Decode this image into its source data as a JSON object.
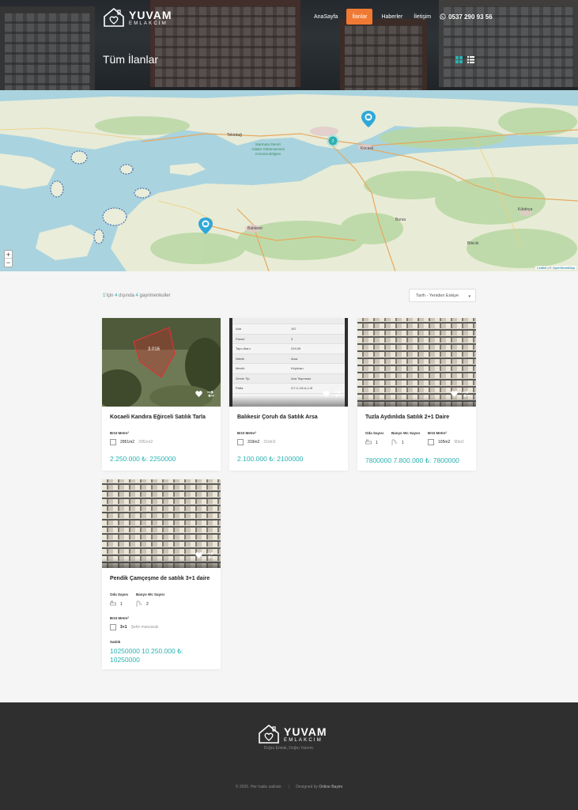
{
  "header": {
    "logo_title": "YUVAM",
    "logo_sub": "EMLAKCIM",
    "nav": [
      "AnaSayfa",
      "İlanlar",
      "Haberler",
      "İletişim"
    ],
    "active_nav": "İlanlar",
    "phone": "0537 290 93 56",
    "page_title": "Tüm İlanlar"
  },
  "map": {
    "labels": [
      "Tekirdağ",
      "Marmara Denizi Adalar Gülümsemesi Koruma Bölgesi",
      "Kocaeli",
      "Balıkesir",
      "Bursa",
      "Bilecik",
      "Kütahya"
    ],
    "cluster_count": "2",
    "zoom_in": "+",
    "zoom_out": "−",
    "attribution_leaflet": "Leaflet",
    "attribution_sep": " | © ",
    "attribution_osm": "OpenStreetMap"
  },
  "listing": {
    "count_prefix": "1",
    "count_mid": "'için ",
    "count_shown": "4",
    "count_text": " dışında ",
    "count_total": "4",
    "count_suffix": " gayrimenkuller",
    "sort_value": "Tarih - Yeniden Eskiye"
  },
  "cards": [
    {
      "title": "Kocaeli Kandıra Eğirceli Satılık Tarla",
      "brut_label": "Brüt Metre²",
      "brut_value": "2951m2",
      "brut_muted": "2951m2",
      "price": "2.250.000 ₺: 2250000",
      "image_label": "3.016"
    },
    {
      "title": "Balıkesir Çoruh da Satılık Arsa",
      "brut_label": "Brüt Metre²",
      "brut_value": "319m2",
      "brut_muted": "319m2",
      "price": "2.100.000 ₺: 2100000",
      "table": [
        [
          "Ada",
          "157"
        ],
        [
          "Parsel",
          "3"
        ],
        [
          "Tapu Alanı",
          "319,05"
        ],
        [
          "Nitelik",
          "Arsa"
        ],
        [
          "Mevkii",
          "Köyüvan"
        ],
        [
          "Zemin Tip",
          "Ana Taşınmaz"
        ],
        [
          "Pafta",
          "İ17-C-25-A-1-B"
        ]
      ]
    },
    {
      "title": "Tuzla Aydınlıda Satılık 2+1 Daire",
      "oda_label": "Oda Sayısı",
      "oda_value": "1",
      "banyo_label": "Banyo Wc Sayısı",
      "banyo_value": "1",
      "brut_label": "Brüt Metre²",
      "brut_value": "105m2",
      "brut_muted": "90m2",
      "price": "7800000 7.800.000 ₺: 7800000"
    },
    {
      "title": "Pendik Çamçeşme de satılık 3+1 daire",
      "oda_label": "Oda Sayısı",
      "oda_value": "1",
      "banyo_label": "Banyo Wc Sayısı",
      "banyo_value": "2",
      "brut_label": "Brüt Metre²",
      "brut_value": "3+1",
      "brut_muted": "Şehir manzaralı",
      "status": "Satılık",
      "price": "10250000 10.250.000 ₺: 10250000"
    }
  ],
  "footer": {
    "logo_title": "YUVAM",
    "logo_sub": "EMLAKCIM",
    "tagline": "Doğru Emlak, Doğru Yatırım.",
    "copyright": "© 2026. Her hakkı saklıdır.",
    "designed_by_prefix": "Designed by ",
    "designed_by": "Online Bayim"
  },
  "colors": {
    "accent": "#f07a34",
    "teal": "#2bb1b1",
    "footer_bg": "#2f2f2f",
    "marker": "#2fa8d8"
  }
}
